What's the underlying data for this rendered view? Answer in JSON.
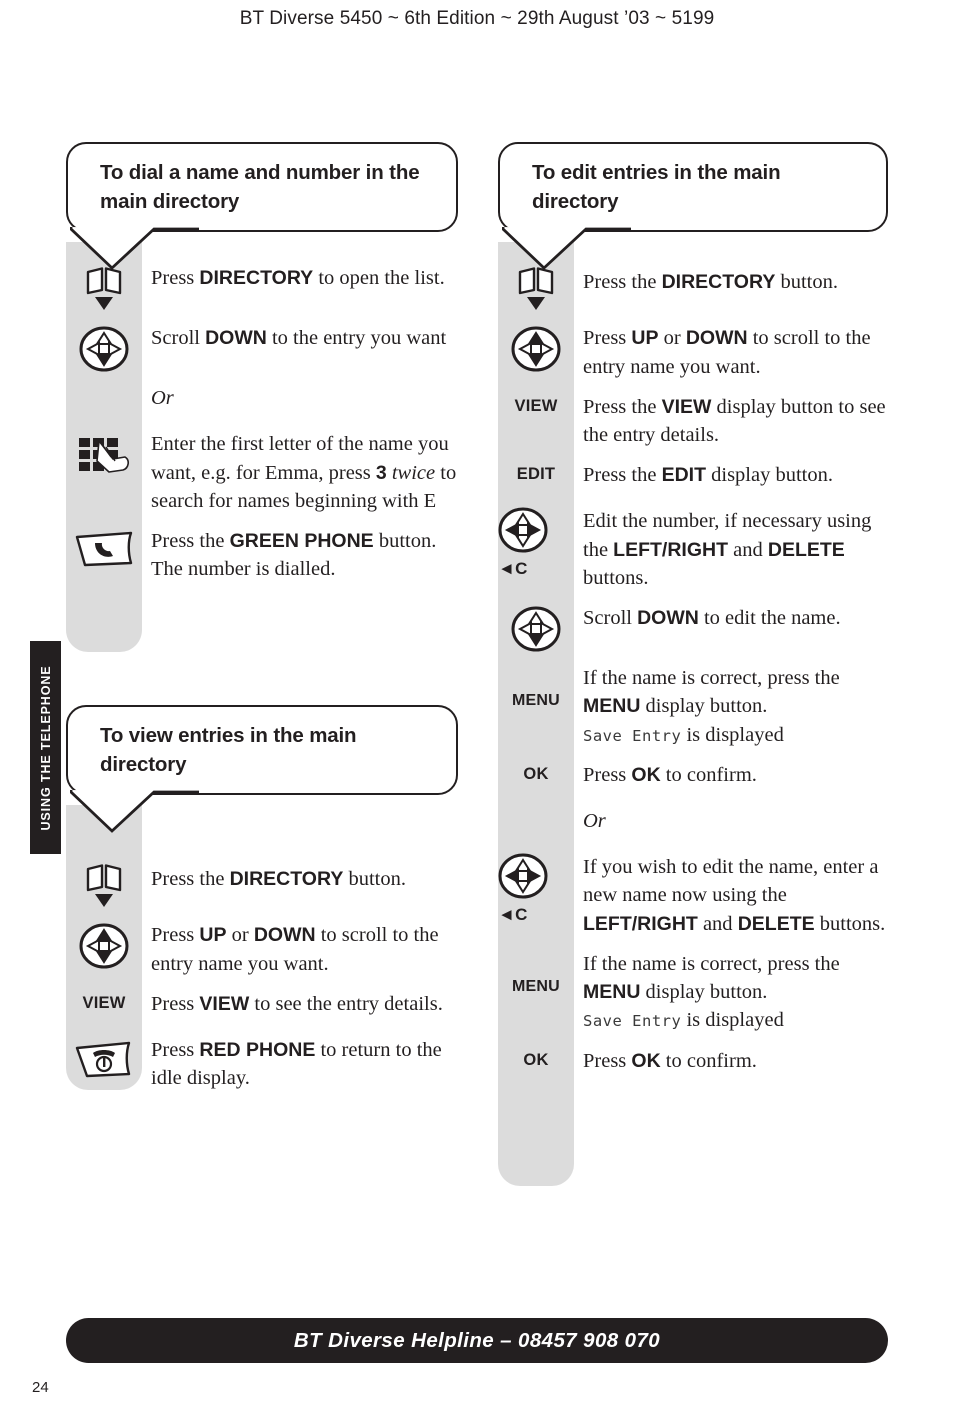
{
  "header": {
    "running_head": "BT Diverse 5450 ~ 6th Edition ~ 29th August ’03 ~ 5199"
  },
  "side_tab": {
    "label": "USING THE TELEPHONE"
  },
  "footer": {
    "helpline": "BT Diverse Helpline – 08457 908 070",
    "page_number": "24"
  },
  "sections": [
    {
      "id": "dial-name-number",
      "title": "To dial a name and number in the main directory",
      "steps": [
        {
          "icon": "directory-book-icon",
          "text_html": "Press <b>DIRECTORY</b> to open the list."
        },
        {
          "icon": "nav-down-icon",
          "text_html": "Scroll <b>DOWN</b> to the entry you want"
        },
        {
          "icon": "none",
          "text_html": "<span class=\"or\">Or</span>"
        },
        {
          "icon": "keypad-hand-icon",
          "text_html": "Enter the first letter of the name you want, e.g. for Emma, press <b>3</b> <i>twice</i> to search for names beginning with E"
        },
        {
          "icon": "green-phone-icon",
          "text_html": "Press the <b>GREEN PHONE</b> button. The number is dialled."
        }
      ]
    },
    {
      "id": "view-entries",
      "title": "To view entries in the main directory",
      "steps": [
        {
          "icon": "directory-book-icon",
          "text_html": "Press the <b>DIRECTORY</b> button."
        },
        {
          "icon": "nav-up-down-icon",
          "text_html": "Press <b>UP</b> or <b>DOWN</b> to scroll to the entry name you want."
        },
        {
          "icon": "softkey-view",
          "icon_label": "VIEW",
          "text_html": "Press <b>VIEW</b> to see the entry details."
        },
        {
          "icon": "red-phone-icon",
          "text_html": "Press <b>RED PHONE</b> to return to the idle display."
        }
      ]
    },
    {
      "id": "edit-entries",
      "title": "To edit entries in the main directory",
      "steps": [
        {
          "icon": "directory-book-icon",
          "text_html": "Press the <b>DIRECTORY</b> button."
        },
        {
          "icon": "nav-up-down-icon",
          "text_html": "Press <b>UP</b> or <b>DOWN</b> to scroll to the entry name you want."
        },
        {
          "icon": "softkey-view",
          "icon_label": "VIEW",
          "text_html": "Press the <b>VIEW</b> display button to see the entry details."
        },
        {
          "icon": "softkey-edit",
          "icon_label": "EDIT",
          "text_html": "Press the <b>EDIT</b> display button."
        },
        {
          "icon": "nav-left-right-delete-icon",
          "icon_label": "◄C",
          "text_html": "Edit the number, if necessary using the <b>LEFT/RIGHT</b> and <b>DELETE</b> buttons."
        },
        {
          "icon": "nav-down-icon",
          "text_html": "Scroll <b>DOWN</b> to edit the name."
        },
        {
          "icon": "softkey-menu",
          "icon_label": "MENU",
          "text_html": "If the name is correct, press the <b>MENU</b> display button.<br><span class=\"lcd\">Save Entry</span> is displayed"
        },
        {
          "icon": "softkey-ok",
          "icon_label": "OK",
          "text_html": "Press <b>OK</b> to confirm."
        },
        {
          "icon": "none",
          "text_html": "<span class=\"or\">Or</span>"
        },
        {
          "icon": "nav-left-right-delete-icon",
          "icon_label": "◄C",
          "text_html": "If you wish to edit the name, enter a new name now using the <b>LEFT/RIGHT</b> and <b>DELETE</b> buttons."
        },
        {
          "icon": "softkey-menu",
          "icon_label": "MENU",
          "text_html": "If the name is correct, press the <b>MENU</b> display button.<br><span class=\"lcd\">Save Entry</span> is displayed"
        },
        {
          "icon": "softkey-ok",
          "icon_label": "OK",
          "text_html": "Press <b>OK</b> to confirm."
        }
      ]
    }
  ],
  "colors": {
    "ink": "#231f20",
    "rail_grey": "#dcdcdc",
    "page": "#ffffff"
  }
}
